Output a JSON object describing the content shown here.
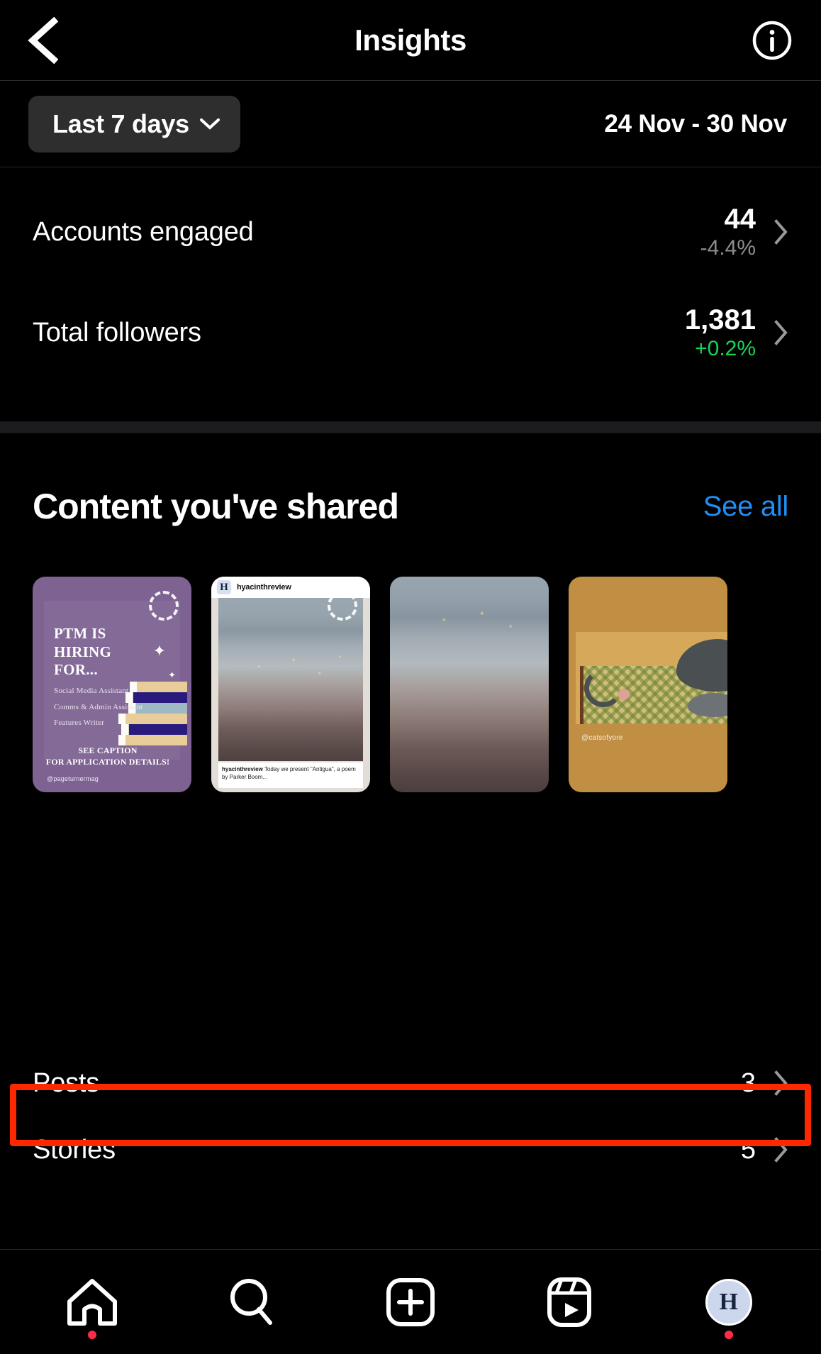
{
  "header": {
    "title": "Insights",
    "back_icon": "chevron-left-icon",
    "info_icon": "info-circle-icon"
  },
  "date_filter": {
    "range_label": "Last 7 days",
    "chevron_icon": "chevron-down-icon",
    "date_range": "24 Nov - 30 Nov"
  },
  "metrics": [
    {
      "label": "Accounts engaged",
      "value": "44",
      "change": "-4.4%",
      "direction": "down",
      "chevron_icon": "chevron-right-icon"
    },
    {
      "label": "Total followers",
      "value": "1,381",
      "change": "+0.2%",
      "direction": "up",
      "chevron_icon": "chevron-right-icon"
    }
  ],
  "content_section": {
    "title": "Content you've shared",
    "see_all_label": "See all",
    "cards": [
      {
        "type": "story-flyer",
        "heading": "PTM IS\nHIRING\nFOR...",
        "roles": [
          "Social Media Assistant",
          "Comms & Admin Assistant",
          "Features Writer"
        ],
        "cta_line1": "SEE CAPTION",
        "cta_line2": "FOR APPLICATION DETAILS!",
        "handle": "@pageturnermag",
        "bg_color": "#7d6292"
      },
      {
        "type": "story-post-preview",
        "username": "hyacinthreview",
        "avatar_letter": "H",
        "caption_author": "hyacinthreview",
        "caption_text": " Today we present \"Antigua\", a poem by Parker Boom..."
      },
      {
        "type": "story-photo"
      },
      {
        "type": "story-photo-watermark",
        "watermark": "@catsofyore",
        "bg_color": "#c18f44"
      }
    ]
  },
  "list_rows": [
    {
      "label": "Posts",
      "value": "3",
      "chevron_icon": "chevron-right-icon",
      "highlighted": false
    },
    {
      "label": "Stories",
      "value": "5",
      "chevron_icon": "chevron-right-icon",
      "highlighted": true
    }
  ],
  "highlight_color": "#fd2800",
  "tabbar": [
    {
      "icon": "home-icon",
      "has_dot": true
    },
    {
      "icon": "search-icon",
      "has_dot": false
    },
    {
      "icon": "create-icon",
      "has_dot": false
    },
    {
      "icon": "reels-icon",
      "has_dot": false
    },
    {
      "icon": "profile-avatar-icon",
      "avatar_letter": "H",
      "has_dot": true
    }
  ]
}
